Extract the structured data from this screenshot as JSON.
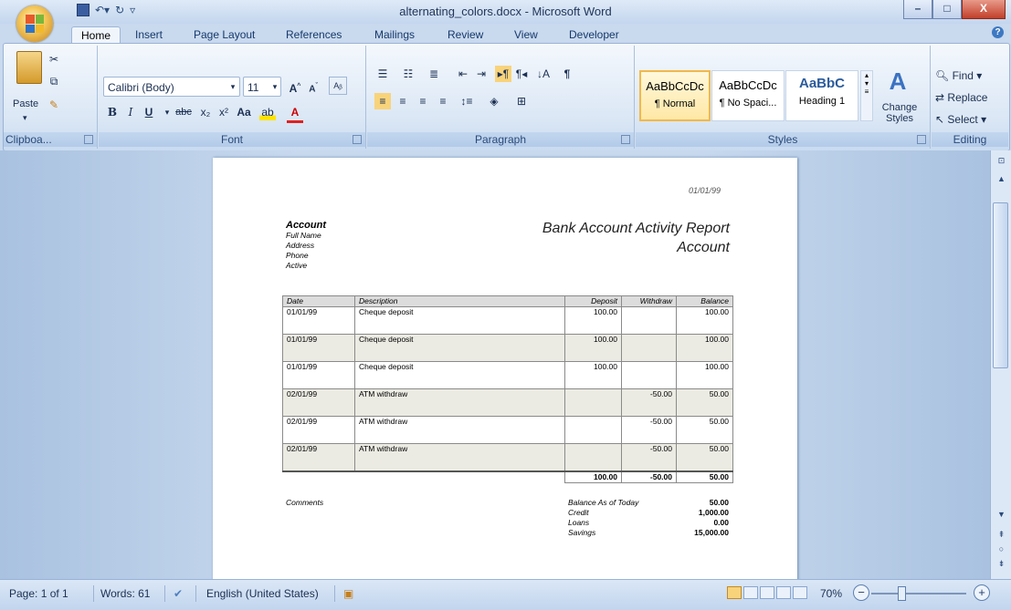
{
  "window": {
    "title": "alternating_colors.docx - Microsoft Word",
    "controls": {
      "minimize": "–",
      "maximize": "□",
      "close": "X"
    }
  },
  "tabs": [
    "Home",
    "Insert",
    "Page Layout",
    "References",
    "Mailings",
    "Review",
    "View",
    "Developer"
  ],
  "active_tab": "Home",
  "ribbon": {
    "clipboard": {
      "label": "Clipboa...",
      "paste": "Paste"
    },
    "font": {
      "label": "Font",
      "family": "Calibri (Body)",
      "size": "11"
    },
    "paragraph": {
      "label": "Paragraph"
    },
    "styles": {
      "label": "Styles",
      "items": [
        {
          "sample": "AaBbCcDc",
          "name": "¶ Normal"
        },
        {
          "sample": "AaBbCcDc",
          "name": "¶ No Spaci..."
        },
        {
          "sample": "AaBbC",
          "name": "Heading 1"
        }
      ],
      "change_styles": "Change Styles"
    },
    "editing": {
      "label": "Editing",
      "find": "Find",
      "replace": "Replace",
      "select": "Select"
    }
  },
  "document": {
    "date": "01/01/99",
    "account_heading": "Account",
    "account_fields": [
      "Full Name",
      "Address",
      "Phone",
      "Active"
    ],
    "report_title": "Bank Account Activity Report",
    "report_subtitle": "Account",
    "table": {
      "headers": [
        "Date",
        "Description",
        "Deposit",
        "Withdraw",
        "Balance"
      ],
      "rows": [
        [
          "01/01/99",
          "Cheque deposit",
          "100.00",
          "",
          "100.00"
        ],
        [
          "01/01/99",
          "Cheque deposit",
          "100.00",
          "",
          "100.00"
        ],
        [
          "01/01/99",
          "Cheque deposit",
          "100.00",
          "",
          "100.00"
        ],
        [
          "02/01/99",
          "ATM withdraw",
          "",
          "-50.00",
          "50.00"
        ],
        [
          "02/01/99",
          "ATM withdraw",
          "",
          "-50.00",
          "50.00"
        ],
        [
          "02/01/99",
          "ATM withdraw",
          "",
          "-50.00",
          "50.00"
        ]
      ],
      "totals": [
        "100.00",
        "-50.00",
        "50.00"
      ]
    },
    "comments_label": "Comments",
    "summary": [
      {
        "label": "Balance As of Today",
        "value": "50.00"
      },
      {
        "label": "Credit",
        "value": "1,000.00"
      },
      {
        "label": "Loans",
        "value": "0.00"
      },
      {
        "label": "Savings",
        "value": "15,000.00"
      }
    ]
  },
  "statusbar": {
    "page": "Page: 1 of 1",
    "words": "Words: 61",
    "language": "English (United States)",
    "zoom": "70%"
  }
}
